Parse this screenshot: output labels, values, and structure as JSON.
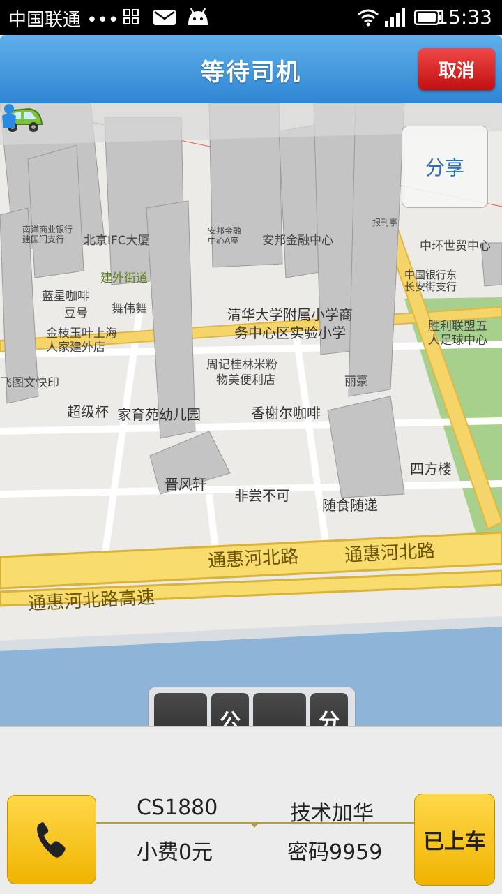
{
  "status_bar": {
    "carrier": "中国联通 •••",
    "time": "15:33"
  },
  "header": {
    "title": "等待司机",
    "cancel_label": "取消"
  },
  "map": {
    "share_label": "分享",
    "pois": [
      "南洋商业银行\n建国门支行",
      "北京IFC大厦",
      "安邦金融\n中心A座",
      "安邦金融中心",
      "报刊亭",
      "中环世贸中心",
      "建外街道",
      "中国银行东\n长安街支行",
      "蓝星咖啡",
      "豆号",
      "舞伟舞",
      "清华大学附属小学商\n务中心区实验小学",
      "胜利联盟五\n人足球中心",
      "金枝玉叶上海\n人家建外店",
      "周记桂林米粉",
      "物美便利店",
      "飞图文快印",
      "丽豪",
      "超级杯",
      "家育苑幼儿园",
      "香榭尔咖啡",
      "四方楼",
      "晋风轩",
      "非尝不可",
      "随食随递"
    ],
    "roads": [
      "通惠河北路",
      "通惠河北路",
      "通惠河北路高速"
    ]
  },
  "trip": {
    "distance_value": "——",
    "distance_unit": "公\n里",
    "time_value": "——",
    "time_unit": "分\n钟"
  },
  "driver": {
    "plate": "CS1880",
    "name": "技术加华",
    "tip": "小费0元",
    "code": "密码9959"
  },
  "actions": {
    "boarded_label": "已上车"
  },
  "colors": {
    "header_blue": "#3a90d9",
    "cancel_red": "#d42020",
    "action_yellow": "#f5c518"
  }
}
